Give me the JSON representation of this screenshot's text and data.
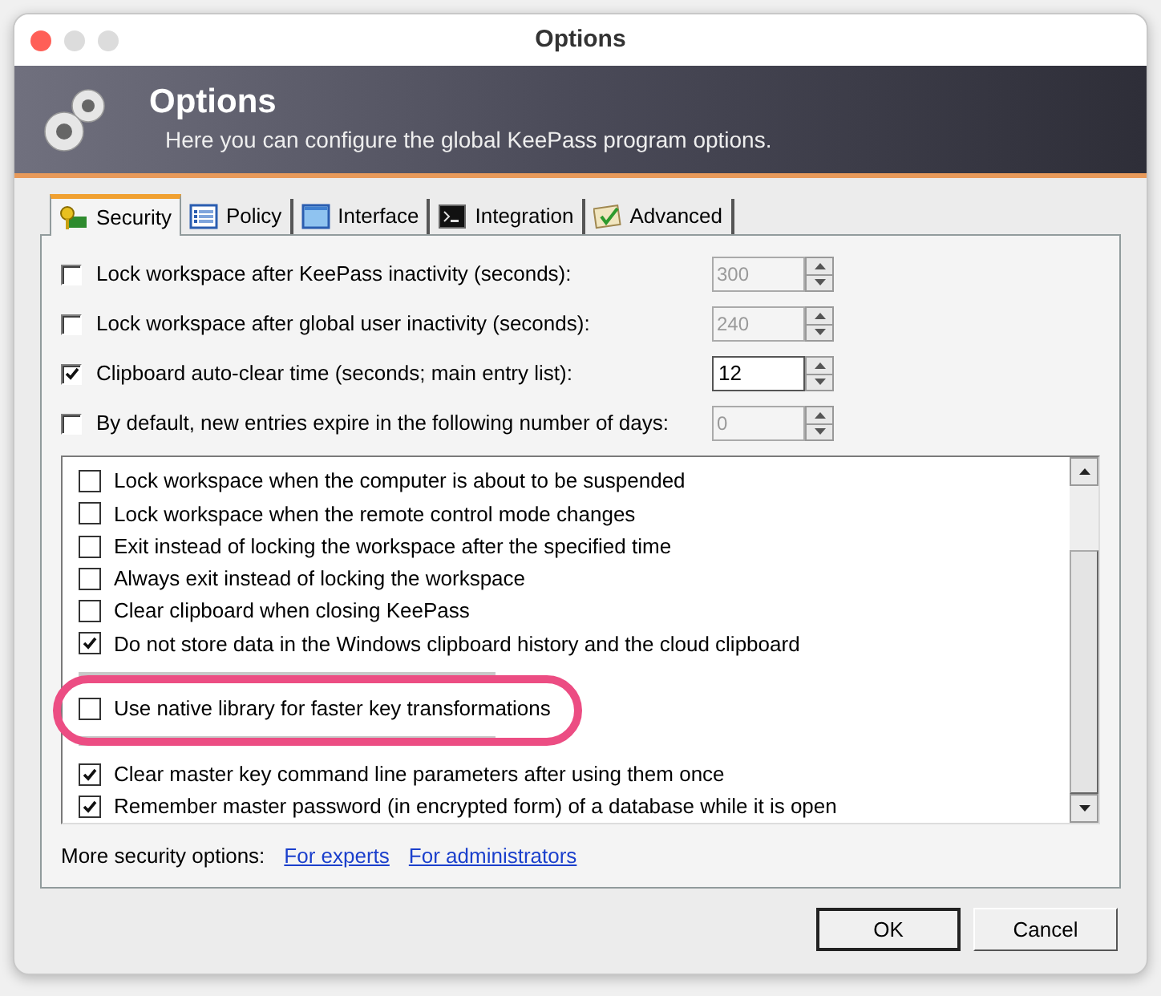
{
  "window": {
    "title": "Options"
  },
  "banner": {
    "title": "Options",
    "subtitle": "Here you can configure the global KeePass program options."
  },
  "tabs": [
    {
      "label": "Security",
      "selected": true
    },
    {
      "label": "Policy",
      "selected": false
    },
    {
      "label": "Interface",
      "selected": false
    },
    {
      "label": "Integration",
      "selected": false
    },
    {
      "label": "Advanced",
      "selected": false
    }
  ],
  "settings": [
    {
      "label": "Lock workspace after KeePass inactivity (seconds):",
      "checked": false,
      "value": "300",
      "disabled": true
    },
    {
      "label": "Lock workspace after global user inactivity (seconds):",
      "checked": false,
      "value": "240",
      "disabled": true
    },
    {
      "label": "Clipboard auto-clear time (seconds; main entry list):",
      "checked": true,
      "value": "12",
      "disabled": false
    },
    {
      "label": "By default, new entries expire in the following number of days:",
      "checked": false,
      "value": "0",
      "disabled": true
    }
  ],
  "options": [
    {
      "kind": "row",
      "label": "Lock workspace when the computer is about to be suspended",
      "checked": false
    },
    {
      "kind": "row",
      "label": "Lock workspace when the remote control mode changes",
      "checked": false
    },
    {
      "kind": "row",
      "label": "Exit instead of locking the workspace after the specified time",
      "checked": false
    },
    {
      "kind": "row",
      "label": "Always exit instead of locking the workspace",
      "checked": false
    },
    {
      "kind": "row",
      "label": "Clear clipboard when closing KeePass",
      "checked": false
    },
    {
      "kind": "row",
      "label": "Do not store data in the Windows clipboard history and the cloud clipboard",
      "checked": true
    },
    {
      "kind": "hidden"
    },
    {
      "kind": "row",
      "label": "Use native library for faster key transformations",
      "checked": false,
      "highlighted": true
    },
    {
      "kind": "hidden"
    },
    {
      "kind": "row",
      "label": "Clear master key command line parameters after using them once",
      "checked": true
    },
    {
      "kind": "row",
      "label": "Remember master password (in encrypted form) of a database while it is open",
      "checked": true
    }
  ],
  "more": {
    "label": "More security options:",
    "links": [
      "For experts",
      "For administrators"
    ]
  },
  "buttons": [
    {
      "label": "OK",
      "default": true
    },
    {
      "label": "Cancel",
      "default": false
    }
  ]
}
